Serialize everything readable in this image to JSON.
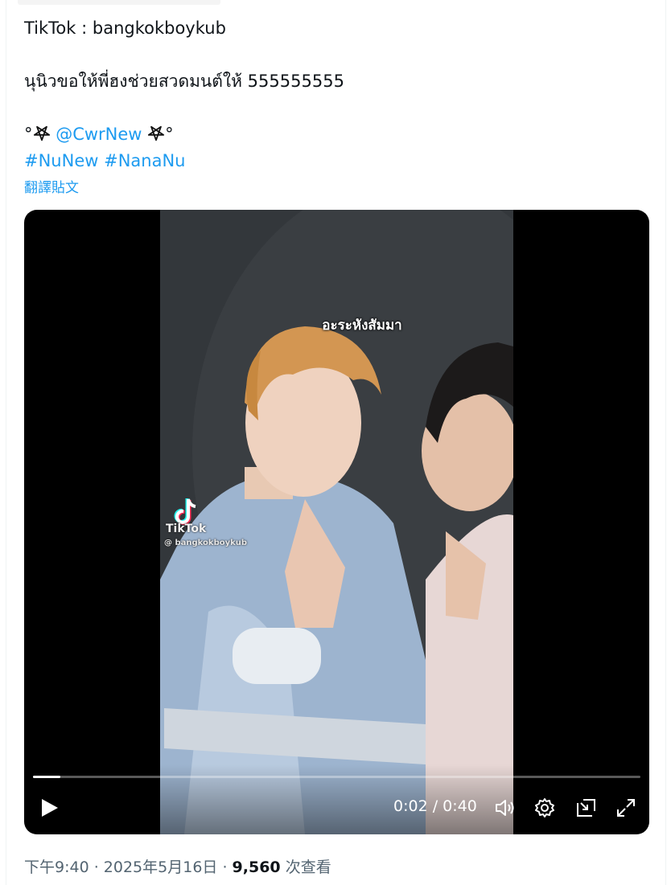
{
  "tweet": {
    "line1": "TikTok : bangkokboykub",
    "line2": "นุนิวขอให้พี่ฮงช่วยสวดมนต์ให้ 555555555",
    "line3_prefix": "°",
    "mention": "@CwrNew",
    "line3_suffix": "°",
    "hashtag1": "#NuNew",
    "hashtag2": "#NanaNu",
    "translate_link": "翻譯貼文"
  },
  "video": {
    "caption": "อะระหังสัมมา",
    "watermark_brand": "TikTok",
    "watermark_handle": "@ bangkokboykub",
    "current_time": "0:02",
    "separator": " / ",
    "duration": "0:40",
    "progress_fraction": 0.045
  },
  "meta": {
    "time": "下午9:40",
    "dot1": " · ",
    "date": "2025年5月16日",
    "dot2": " · ",
    "views": "9,560",
    "views_label": " 次查看"
  },
  "colors": {
    "link": "#1d9bf0",
    "text": "#0f1419",
    "muted": "#536471"
  },
  "icons": [
    "pentagram-icon",
    "play-icon",
    "volume-icon",
    "settings-icon",
    "picture-in-picture-icon",
    "fullscreen-icon",
    "tiktok-logo-icon"
  ]
}
